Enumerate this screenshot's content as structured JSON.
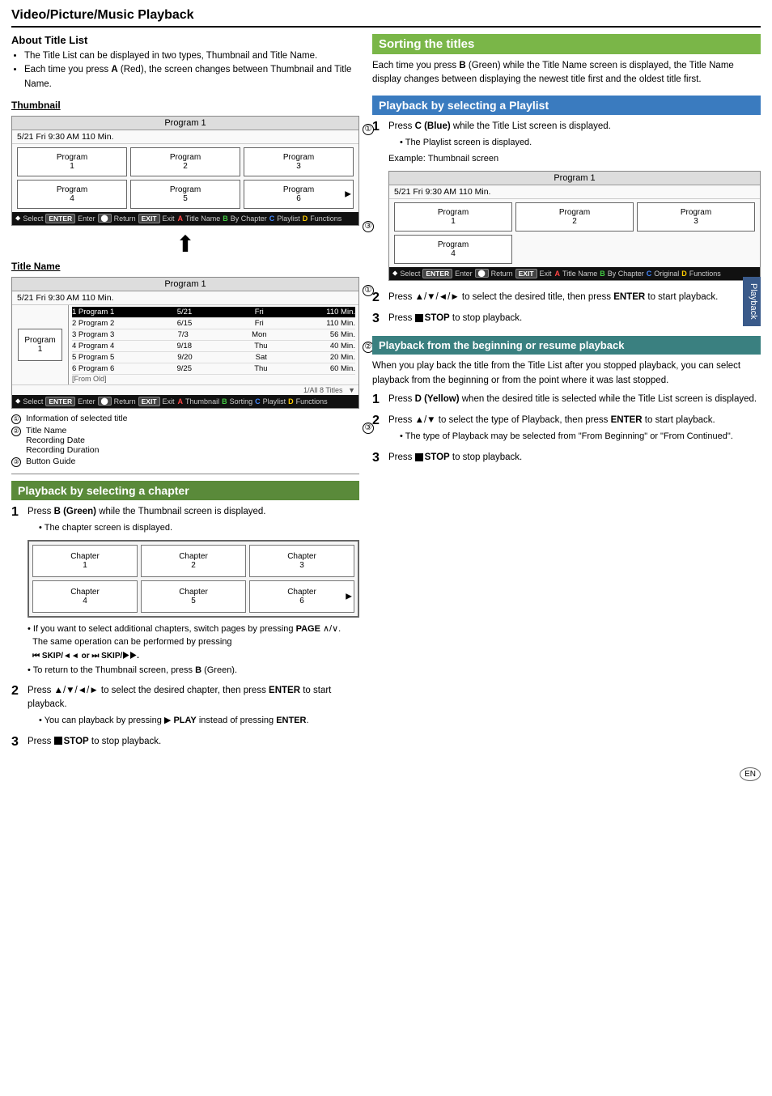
{
  "header": {
    "title": "Video/Picture/Music Playback"
  },
  "left": {
    "about_title_list": {
      "heading": "About Title List",
      "bullets": [
        "The Title List can be displayed in two types, Thumbnail and Title Name.",
        "Each time you press A (Red), the screen changes between Thumbnail and Title Name."
      ]
    },
    "thumbnail_label": "Thumbnail",
    "thumbnail_screen": {
      "program_header": "Program 1",
      "info_row": "5/21   Fri   9:30 AM   110 Min.",
      "programs": [
        "Program\n1",
        "Program\n2",
        "Program\n3",
        "Program\n4",
        "Program\n5",
        "Program\n6"
      ],
      "controls_row1": "⬥ Select   ENTER Enter   ⬤ Return   EXIT Exit",
      "controls_row2": "A Title Name  B By Chapter  C Playlist  D Functions"
    },
    "title_name_label": "Title Name",
    "title_name_screen": {
      "program_header": "Program 1",
      "info_row": "5/21   Fri   9:30 AM   110 Min.",
      "left_cell": "Program\n1",
      "rows": [
        {
          "num": "1",
          "name": "Program 1",
          "date": "5/21",
          "day": "Fri",
          "dur": "110 Min.",
          "selected": true
        },
        {
          "num": "2",
          "name": "Program 2",
          "date": "6/15",
          "day": "Fri",
          "dur": "110 Min.",
          "selected": false
        },
        {
          "num": "3",
          "name": "Program 3",
          "date": "7/3",
          "day": "Mon",
          "dur": "56 Min.",
          "selected": false
        },
        {
          "num": "4",
          "name": "Program 4",
          "date": "9/18",
          "day": "Thu",
          "dur": "40 Min.",
          "selected": false
        },
        {
          "num": "5",
          "name": "Program 5",
          "date": "9/20",
          "day": "Sat",
          "dur": "20 Min.",
          "selected": false
        },
        {
          "num": "6",
          "name": "Program 6",
          "date": "9/25",
          "day": "Thu",
          "dur": "60 Min.",
          "selected": false
        }
      ],
      "from_old": "[From Old]",
      "footer": "1/All 8 Titles",
      "controls_row1": "⬥ Select   ENTER Enter   ⬤ Return   EXIT Exit",
      "controls_row2": "A Thumbnail  B Sorting  C Playlist  D Functions"
    },
    "annotations": [
      {
        "num": "1",
        "text": "Information of selected title"
      },
      {
        "num": "2",
        "text": "Title Name\nRecording Date\nRecording Duration"
      },
      {
        "num": "3",
        "text": "Button Guide"
      }
    ],
    "chapter_section": {
      "heading": "Playback by selecting a chapter",
      "step1_bold": "B (Green)",
      "step1_text": " while the Thumbnail screen is displayed.",
      "step1_bullet": "The chapter screen is displayed.",
      "chapters": [
        "Chapter\n1",
        "Chapter\n2",
        "Chapter\n3",
        "Chapter\n4",
        "Chapter\n5",
        "Chapter\n6"
      ],
      "bullet1": "If you want to select additional chapters, switch pages by pressing PAGE ∧/∨.",
      "bullet2": "The same operation can be performed by pressing",
      "skip_text": "⏮ SKIP/◄◄  or  ⏭ SKIP/▶▶.",
      "bullet3": "To return to the Thumbnail screen, press B (Green).",
      "step2_text": "Press ▲/▼/◄/► to select the desired chapter, then press ",
      "step2_bold": "ENTER",
      "step2_text2": " to start playback.",
      "step2_bullet": "You can playback by pressing ▶ PLAY instead of pressing ENTER.",
      "step3_text": "Press ",
      "step3_stop": "■",
      "step3_bold": "STOP",
      "step3_text2": " to stop playback."
    }
  },
  "right": {
    "sorting_heading": "Sorting the titles",
    "sorting_text": "Each time you press B (Green) while the Title Name screen is displayed, the Title Name display changes between displaying the newest title first and the oldest title first.",
    "playlist_heading": "Playback by selecting a Playlist",
    "playlist_step1_text": "Press ",
    "playlist_step1_bold": "C (Blue)",
    "playlist_step1_text2": " while the Title List screen is displayed.",
    "playlist_step1_bullet": "The Playlist screen is displayed.",
    "playlist_example": "Example: Thumbnail screen",
    "playlist_screen": {
      "program_header": "Program 1",
      "info_row": "5/21   Fri   9:30 AM   110 Min.",
      "programs": [
        "Program\n1",
        "Program\n2",
        "Program\n3",
        "Program\n4"
      ],
      "controls_row1": "⬥ Select   ENTER Enter   ⬤ Return   EXIT Exit",
      "controls_row2": "A Title Name  B By Chapter  C Original  D Functions"
    },
    "playlist_step2_text": "Press ▲/▼/◄/► to select the desired title, then press ",
    "playlist_step2_bold": "ENTER",
    "playlist_step2_text2": " to start playback.",
    "playlist_step3_text": "Press ",
    "playlist_step3_stop": "■",
    "playlist_step3_bold": "STOP",
    "playlist_step3_text2": " to stop playback.",
    "resume_heading": "Playback from the beginning or resume playback",
    "resume_text": "When you play back the title from the Title List after you stopped playback, you can select playback from the beginning or from the point where it was last stopped.",
    "resume_step1_text": "Press ",
    "resume_step1_bold": "D (Yellow)",
    "resume_step1_text2": " when the desired title is selected while the Title List screen is displayed.",
    "resume_step2_text": "Press ▲/▼ to select the type of Playback, then press ",
    "resume_step2_bold": "ENTER",
    "resume_step2_text2": " to start playback.",
    "resume_step2_bullet": "The type of Playback may be selected from \"From Beginning\" or \"From Continued\".",
    "resume_step3_text": "Press ",
    "resume_step3_stop": "■",
    "resume_step3_bold": "STOP",
    "resume_step3_text2": " to stop playback.",
    "tab_label": "Playback"
  }
}
